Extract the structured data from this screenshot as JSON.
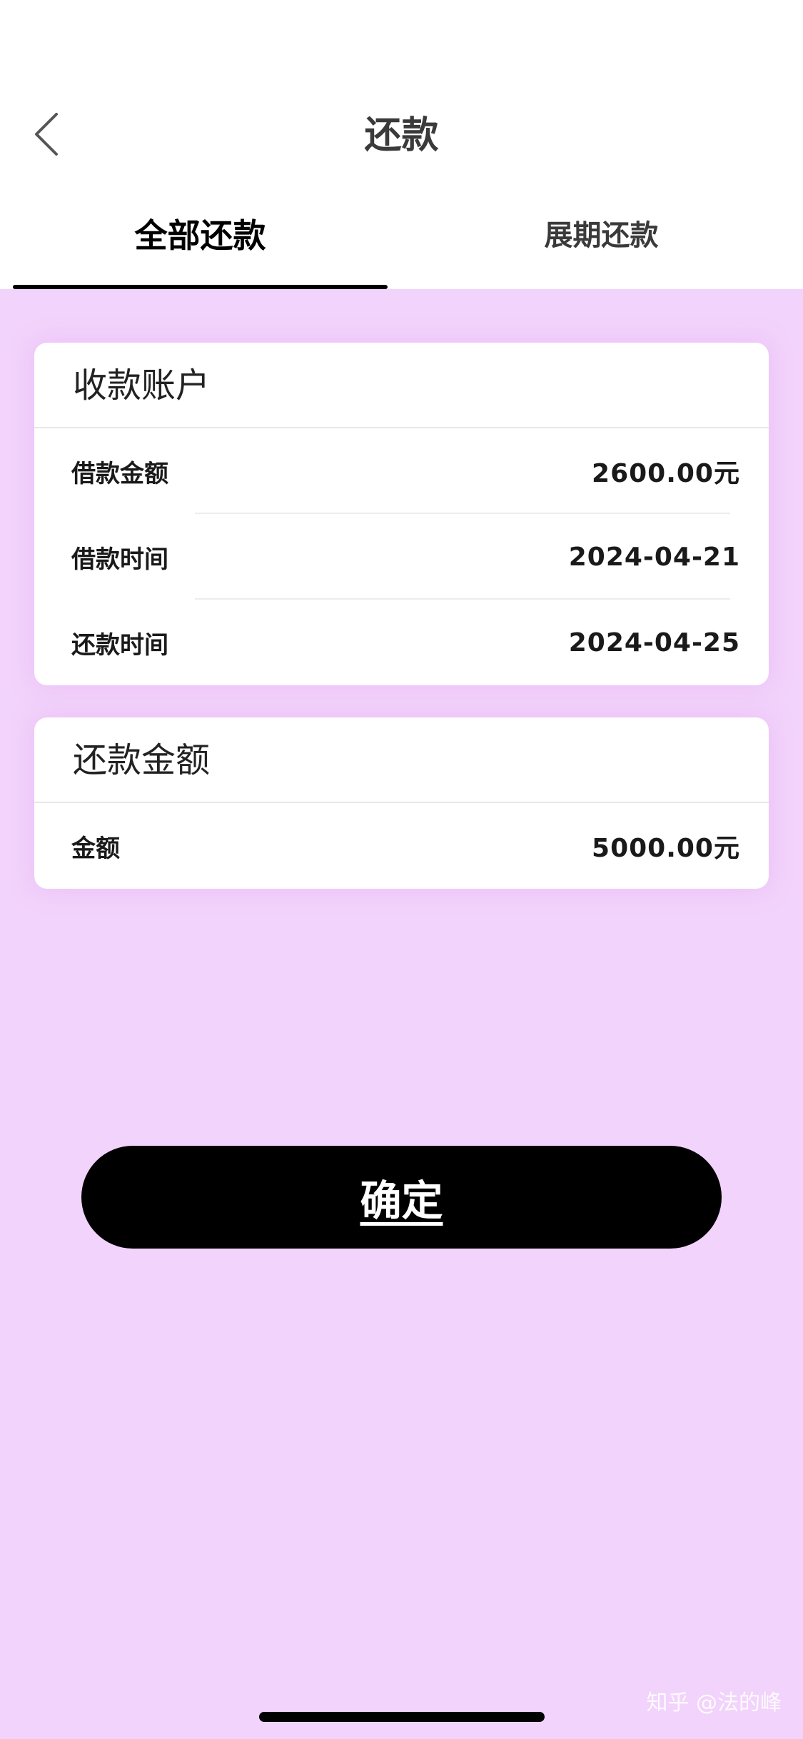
{
  "header": {
    "title": "还款",
    "back_icon": "chevron-left-icon"
  },
  "tabs": [
    {
      "label": "全部还款",
      "active": true
    },
    {
      "label": "展期还款",
      "active": false
    }
  ],
  "account_card": {
    "title": "收款账户",
    "rows": [
      {
        "label": "借款金额",
        "value": "2600.00元"
      },
      {
        "label": "借款时间",
        "value": "2024-04-21"
      },
      {
        "label": "还款时间",
        "value": "2024-04-25"
      }
    ]
  },
  "repay_card": {
    "title": "还款金额",
    "rows": [
      {
        "label": "金额",
        "value": "5000.00元"
      }
    ]
  },
  "confirm_button": {
    "label": "确定"
  },
  "watermark": "知乎 @法的峰",
  "colors": {
    "page_background": "#f2d3fb",
    "button_background": "#000000",
    "card_background": "#ffffff"
  }
}
